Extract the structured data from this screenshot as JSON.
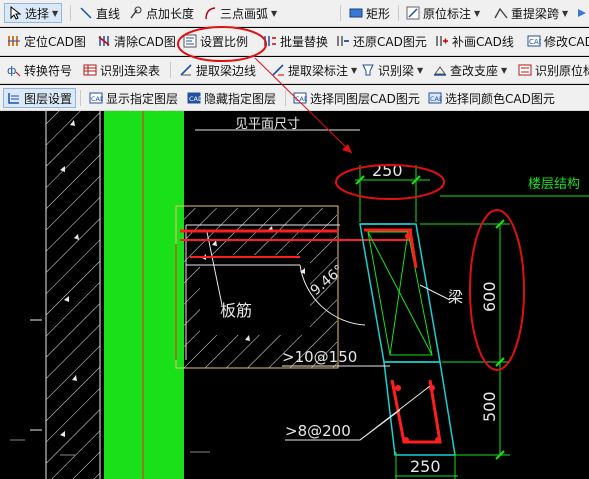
{
  "toolbar1": {
    "select": "选择",
    "line": "直线",
    "point_length": "点加长度",
    "three_point_arc": "三点画弧",
    "rect": "矩形",
    "original_dim": "原位标注",
    "re_extract_span": "重提梁跨"
  },
  "toolbar2": {
    "locate_cad": "定位CAD图",
    "clear_cad": "清除CAD图",
    "set_scale": "设置比例",
    "batch_replace": "批量替换",
    "restore_cad": "还原CAD图元",
    "supplement_cad_line": "补画CAD线",
    "modify_cad": "修改CAD"
  },
  "toolbar3": {
    "convert_symbol": "转换符号",
    "identify_beam_table": "识别连梁表",
    "extract_beam_edge": "提取梁边线",
    "extract_beam_label": "提取梁标注",
    "identify_beam": "识别梁",
    "check_support": "查改支座",
    "identify_original_dim": "识别原位标"
  },
  "toolbar4": {
    "layer_settings": "图层设置",
    "show_layer": "显示指定图层",
    "hide_layer": "隐藏指定图层",
    "select_same_layer": "选择同图层CAD图元",
    "select_same_color": "选择同颜色CAD图元"
  },
  "drawing": {
    "top_label": "见平面尺寸",
    "dim_top_250": "250",
    "dim_600": "600",
    "dim_500": "500",
    "dim_bottom_250": "250",
    "angle": "9.46°",
    "slab_rebar": "板筋",
    "beam_label": "梁",
    "floor_label": "楼层结构",
    "rebar_10_150": ">10@150",
    "rebar_8_200": ">8@200"
  },
  "colors": {
    "annotation_red": "#e01010",
    "cad_green": "#19e019",
    "cad_cyan": "#18d0d0",
    "cad_red": "#ff1e1e",
    "cad_white": "#e8e8e8"
  }
}
